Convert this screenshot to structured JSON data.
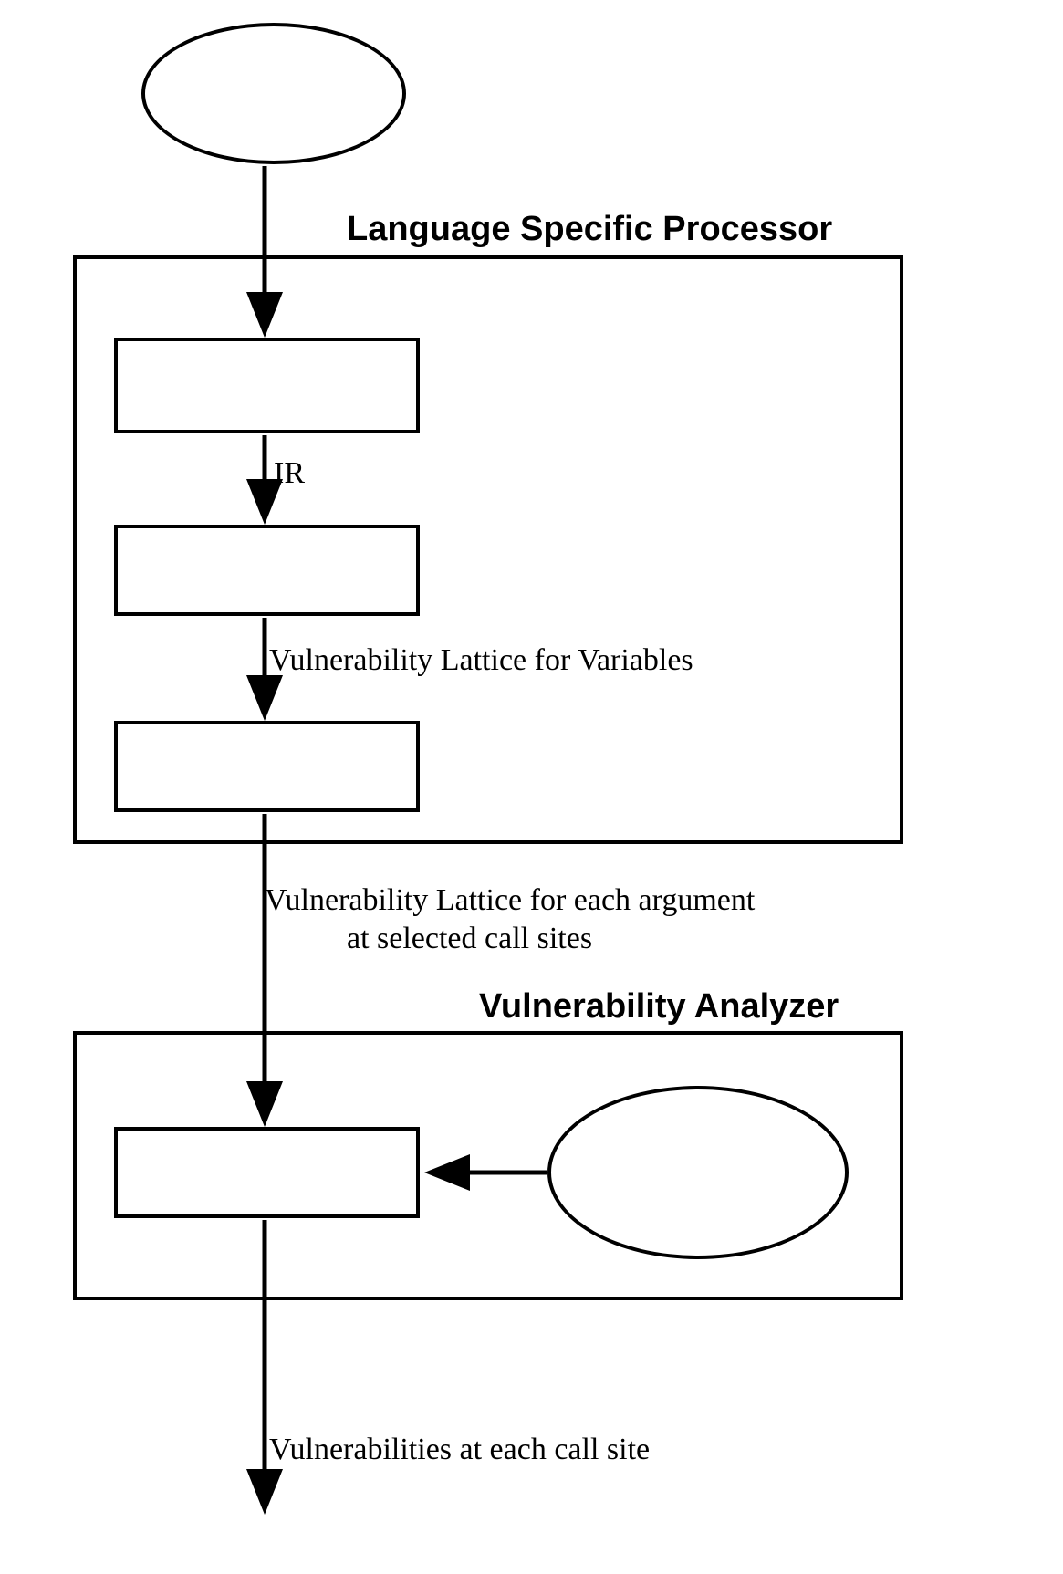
{
  "section1_title": "Language Specific Processor",
  "section2_title": "Vulnerability Analyzer",
  "edge_ir": "IR",
  "edge_vlv": "Vulnerability Lattice for Variables",
  "edge_vlarg_line1": "Vulnerability Lattice for each argument",
  "edge_vlarg_line2": "at selected call sites",
  "edge_vcs": "Vulnerabilities at each call site"
}
